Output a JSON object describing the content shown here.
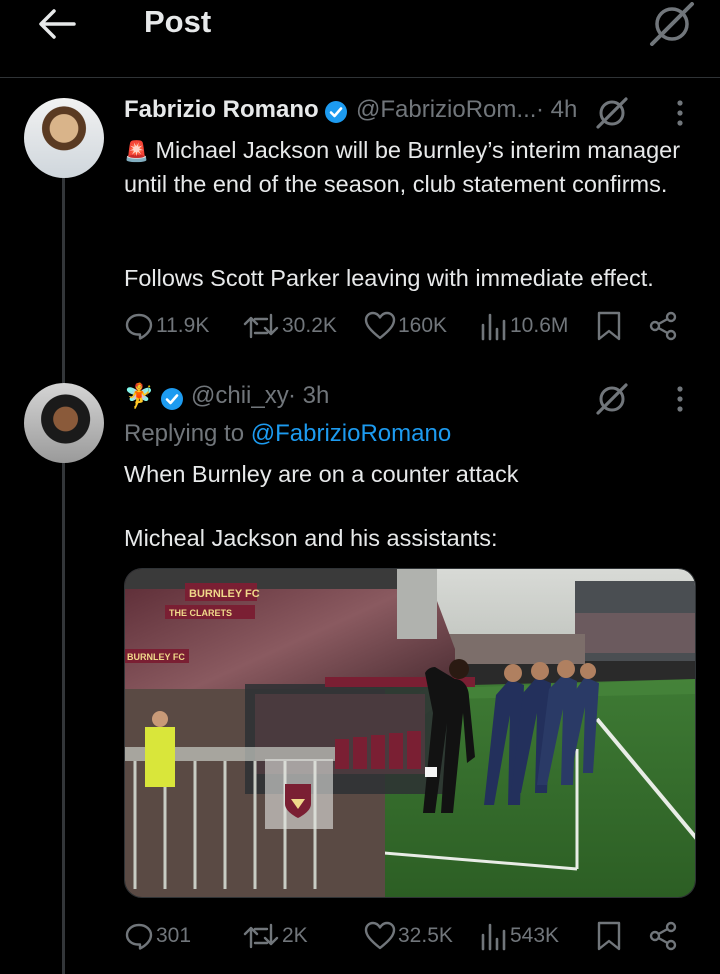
{
  "header": {
    "title": "Post"
  },
  "tweet1": {
    "author": "Fabrizio Romano",
    "handle": "@FabrizioRom...",
    "time": "· 4h",
    "siren": "🚨",
    "text1": "Michael Jackson will be Burnley’s interim manager until the end of the season, club statement confirms.",
    "text2": "Follows Scott Parker leaving with immediate effect.",
    "stats": {
      "replies": "11.9K",
      "reposts": "30.2K",
      "likes": "160K",
      "views": "10.6M"
    }
  },
  "tweet2": {
    "emoji": "🧚",
    "handle": "@chii_xy",
    "time": "· 3h",
    "replying_prefix": "Replying to",
    "replying_handle": "@FabrizioRomano",
    "text1": "When Burnley are on a counter attack",
    "text2": "Micheal Jackson and his assistants:",
    "stats": {
      "replies": "301",
      "reposts": "2K",
      "likes": "32.5K",
      "views": "543K"
    }
  },
  "photo_signs": {
    "burnley_fc": "BURNLEY FC",
    "the_clarets": "THE CLARETS",
    "burnley_fc_stand": "BURNLEY FC"
  },
  "colors": {
    "background": "#000000",
    "text": "#e7e9ea",
    "muted": "#71767b",
    "link": "#1d9bf0",
    "verified": "#1d9bf0",
    "divider": "#2f3336"
  },
  "icons": [
    "back-arrow-icon",
    "grok-icon",
    "verified-badge-icon",
    "more-icon",
    "reply-icon",
    "repost-icon",
    "like-icon",
    "views-icon",
    "bookmark-icon",
    "share-icon"
  ]
}
